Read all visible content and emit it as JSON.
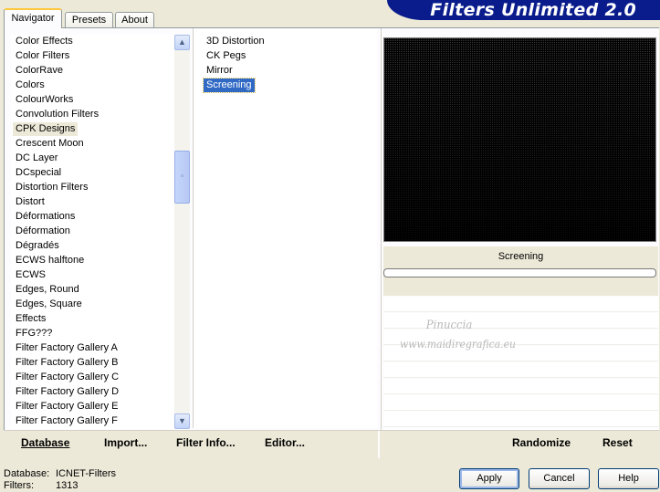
{
  "banner": {
    "title": "Filters Unlimited 2.0"
  },
  "tabs": [
    {
      "label": "Navigator"
    },
    {
      "label": "Presets"
    },
    {
      "label": "About"
    }
  ],
  "categories": [
    {
      "label": "Color Effects"
    },
    {
      "label": "Color Filters"
    },
    {
      "label": "ColorRave"
    },
    {
      "label": "Colors"
    },
    {
      "label": "ColourWorks"
    },
    {
      "label": "Convolution Filters"
    },
    {
      "label": "CPK Designs"
    },
    {
      "label": "Crescent Moon"
    },
    {
      "label": "DC Layer"
    },
    {
      "label": "DCspecial"
    },
    {
      "label": "Distortion Filters"
    },
    {
      "label": "Distort"
    },
    {
      "label": "Déformations"
    },
    {
      "label": "Déformation"
    },
    {
      "label": "Dégradés"
    },
    {
      "label": "ECWS halftone"
    },
    {
      "label": "ECWS"
    },
    {
      "label": "Edges, Round"
    },
    {
      "label": "Edges, Square"
    },
    {
      "label": "Effects"
    },
    {
      "label": "FFG???"
    },
    {
      "label": "Filter Factory Gallery A"
    },
    {
      "label": "Filter Factory Gallery B"
    },
    {
      "label": "Filter Factory Gallery C"
    },
    {
      "label": "Filter Factory Gallery D"
    },
    {
      "label": "Filter Factory Gallery E"
    },
    {
      "label": "Filter Factory Gallery F"
    }
  ],
  "selected_category": "CPK Designs",
  "filters": [
    {
      "label": "3D Distortion"
    },
    {
      "label": "CK Pegs"
    },
    {
      "label": "Mirror"
    },
    {
      "label": "Screening"
    }
  ],
  "selected_filter": "Screening",
  "preview": {
    "label": "Screening"
  },
  "watermark": {
    "line1": "Pinuccia",
    "line2": "www.maidiregrafica.eu"
  },
  "links": {
    "database": "Database",
    "import": "Import...",
    "filter_info": "Filter Info...",
    "editor": "Editor...",
    "randomize": "Randomize",
    "reset": "Reset"
  },
  "info": {
    "database_label": "Database:",
    "database_value": "ICNET-Filters",
    "filters_label": "Filters:",
    "filters_value": "1313"
  },
  "buttons": {
    "apply": "Apply",
    "cancel": "Cancel",
    "help": "Help"
  },
  "colors": {
    "banner": "#0a1c8c",
    "selection": "#316ac5",
    "dialog_bg": "#ece9d8"
  }
}
